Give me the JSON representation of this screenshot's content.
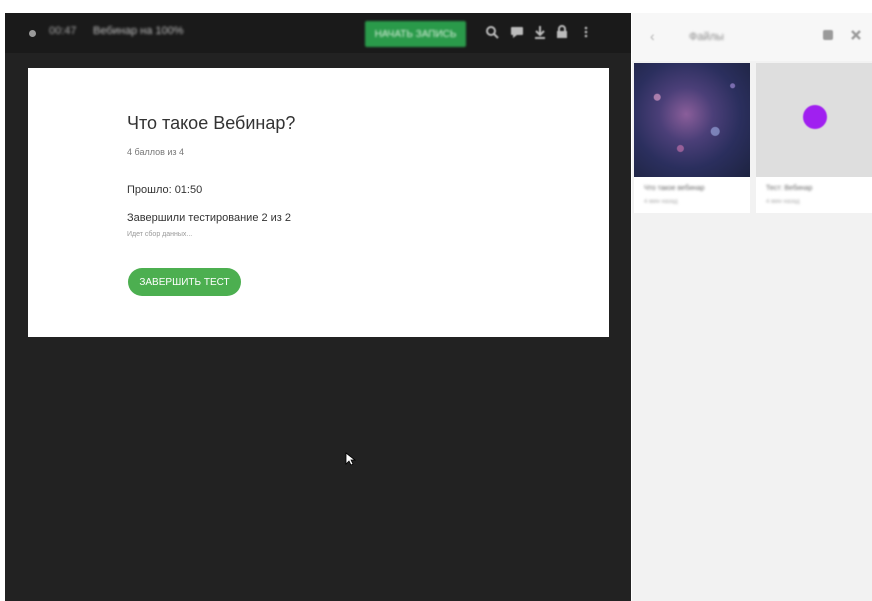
{
  "topbar": {
    "time": "00:47",
    "title": "Вебинар на 100%",
    "start_label": "НАЧАТЬ ЗАПИСЬ",
    "icons": [
      "record-dot-icon",
      "search-icon",
      "chat-icon",
      "download-icon",
      "lock-icon",
      "more-icon"
    ]
  },
  "card": {
    "title": "Что такое Вебинар?",
    "score": "4 баллов из 4",
    "elapsed_label": "Прошло:",
    "elapsed_value": "01:50",
    "finished": "Завершили тестирование 2 из 2",
    "collecting": "Идет сбор данных...",
    "finish_button": "ЗАВЕРШИТЬ ТЕСТ"
  },
  "panel": {
    "back": "‹",
    "title": "Файлы",
    "icons": [
      "settings-icon",
      "close-icon"
    ],
    "tiles": [
      {
        "caption": "Что такое вебинар",
        "sub": "4 мин назад"
      },
      {
        "caption": "Тест: Вебинар",
        "sub": "4 мин назад"
      }
    ]
  },
  "colors": {
    "accent": "#4caf50",
    "topbar_button": "#2a9a4a",
    "stage_bg": "#222222",
    "panel_bg": "#f2f2f2",
    "dot": "#a020f0"
  }
}
